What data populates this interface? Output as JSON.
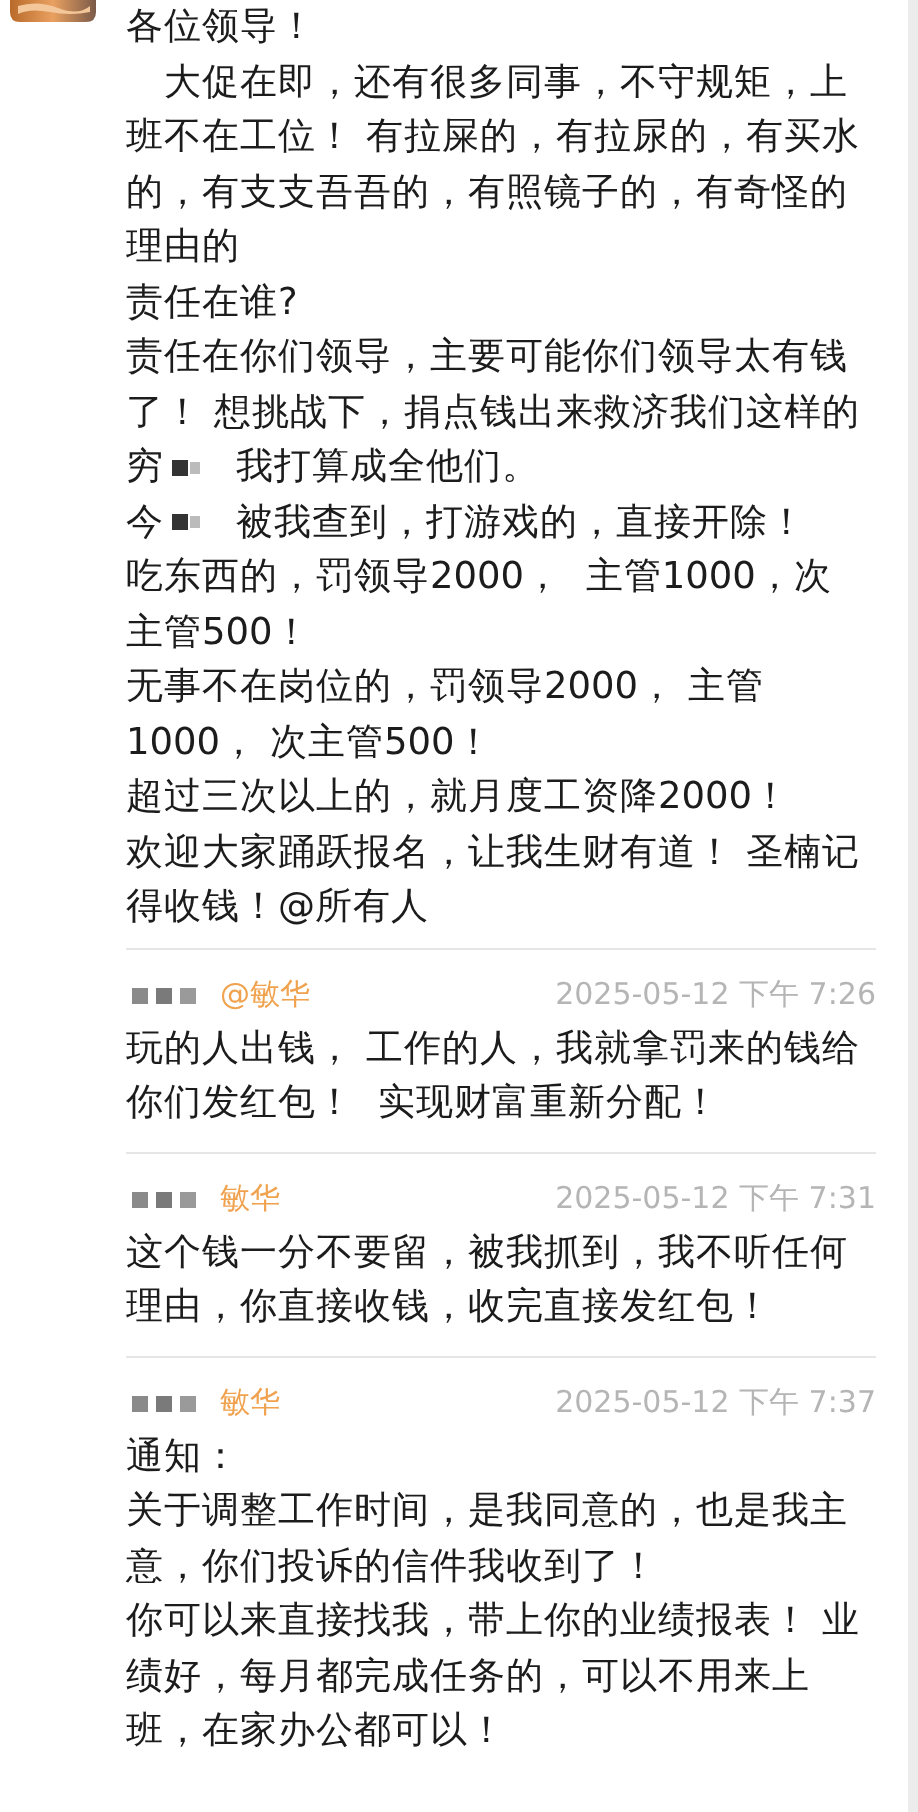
{
  "messages": [
    {
      "lines": [
        {
          "kind": "text",
          "text": "各位领导！"
        },
        {
          "kind": "text",
          "text": "　大促在即，还有很多同事，不守规矩，上"
        },
        {
          "kind": "text",
          "text": "班不在工位！ 有拉屎的，有拉尿的，有买水"
        },
        {
          "kind": "text",
          "text": "的，有支支吾吾的，有照镜子的，有奇怪的"
        },
        {
          "kind": "text",
          "text": "理由的"
        },
        {
          "kind": "text",
          "text": "责任在谁?"
        },
        {
          "kind": "text",
          "text": "责任在你们领导，主要可能你们领导太有钱"
        },
        {
          "kind": "text",
          "text": "了！ 想挑战下，捐点钱出来救济我们这样的"
        },
        {
          "kind": "redacted",
          "before": "穷",
          "after": "我打算成全他们。"
        },
        {
          "kind": "redacted",
          "before": "今",
          "after": "被我查到，打游戏的，直接开除！"
        },
        {
          "kind": "text",
          "text": "吃东西的，罚领导2000，  主管1000，次"
        },
        {
          "kind": "text",
          "text": "主管500！"
        },
        {
          "kind": "text",
          "text": "无事不在岗位的，罚领导2000， 主管"
        },
        {
          "kind": "text",
          "text": "1000， 次主管500！"
        },
        {
          "kind": "text",
          "text": "超过三次以上的，就月度工资降2000！"
        },
        {
          "kind": "text",
          "text": "欢迎大家踊跃报名，让我生财有道！ 圣楠记"
        },
        {
          "kind": "text",
          "text": "得收钱！@所有人"
        }
      ]
    },
    {
      "sender": "@敏华",
      "time": "2025-05-12 下午 7:26",
      "lines": [
        {
          "kind": "text",
          "text": "玩的人出钱， 工作的人，我就拿罚来的钱给"
        },
        {
          "kind": "text",
          "text": "你们发红包！  实现财富重新分配！"
        }
      ]
    },
    {
      "sender": "敏华",
      "time": "2025-05-12 下午 7:31",
      "lines": [
        {
          "kind": "text",
          "text": "这个钱一分不要留，被我抓到，我不听任何"
        },
        {
          "kind": "text",
          "text": "理由，你直接收钱，收完直接发红包！"
        }
      ]
    },
    {
      "sender": "敏华",
      "time": "2025-05-12 下午 7:37",
      "lines": [
        {
          "kind": "text",
          "text": "通知："
        },
        {
          "kind": "text",
          "text": "关于调整工作时间，是我同意的，也是我主"
        },
        {
          "kind": "text",
          "text": "意，你们投诉的信件我收到了！"
        },
        {
          "kind": "text",
          "text": "你可以来直接找我，带上你的业绩报表！ 业"
        },
        {
          "kind": "text",
          "text": "绩好，每月都完成任务的，可以不用来上"
        },
        {
          "kind": "text",
          "text": "班，在家办公都可以！"
        }
      ]
    }
  ]
}
